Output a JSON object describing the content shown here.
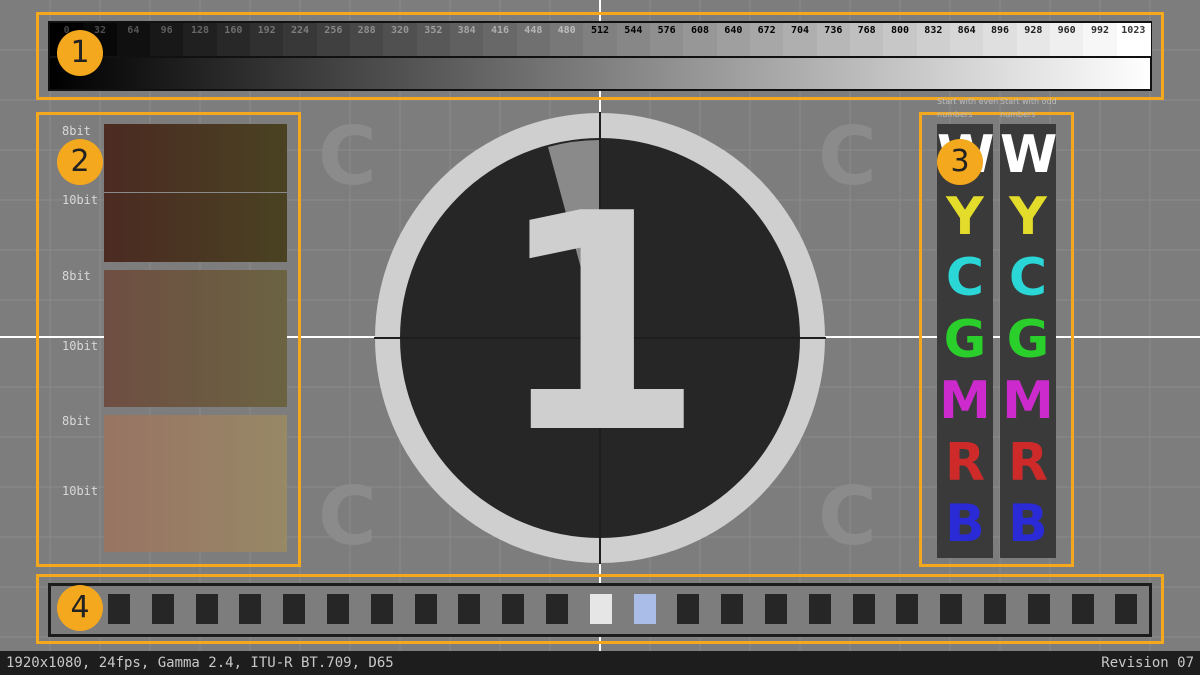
{
  "grayscale": {
    "ticks": [
      "0",
      "32",
      "64",
      "96",
      "128",
      "160",
      "192",
      "224",
      "256",
      "288",
      "320",
      "352",
      "384",
      "416",
      "448",
      "480",
      "512",
      "544",
      "576",
      "608",
      "640",
      "672",
      "704",
      "736",
      "768",
      "800",
      "832",
      "864",
      "896",
      "928",
      "960",
      "992",
      "1023"
    ]
  },
  "badges": [
    "1",
    "2",
    "3",
    "4"
  ],
  "color_panels": {
    "label_8bit": "8bit",
    "label_10bit": "10bit",
    "panels": [
      {
        "from": "#4b2a22",
        "to": "#4a4222"
      },
      {
        "from": "#6e4e42",
        "to": "#6b6342"
      },
      {
        "from": "#987463",
        "to": "#978866"
      }
    ]
  },
  "countdown": {
    "number": "1"
  },
  "background_letter": "C",
  "letters": {
    "note_even": "Start with even numbers",
    "note_odd": "Start with odd numbers",
    "items": [
      {
        "char": "W",
        "color": "#ffffff"
      },
      {
        "char": "Y",
        "color": "#e4dc2a"
      },
      {
        "char": "C",
        "color": "#2ad6d6"
      },
      {
        "char": "G",
        "color": "#2bcf2b"
      },
      {
        "char": "M",
        "color": "#cc2acc"
      },
      {
        "char": "R",
        "color": "#cf2a2a"
      },
      {
        "char": "B",
        "color": "#2a2ad6"
      }
    ]
  },
  "squares": {
    "count": 24,
    "highlight_white_index": 11,
    "highlight_blue_index": 12
  },
  "footer": {
    "left": "1920x1080, 24fps, Gamma 2.4, ITU-R BT.709, D65",
    "right": "Revision 07"
  }
}
